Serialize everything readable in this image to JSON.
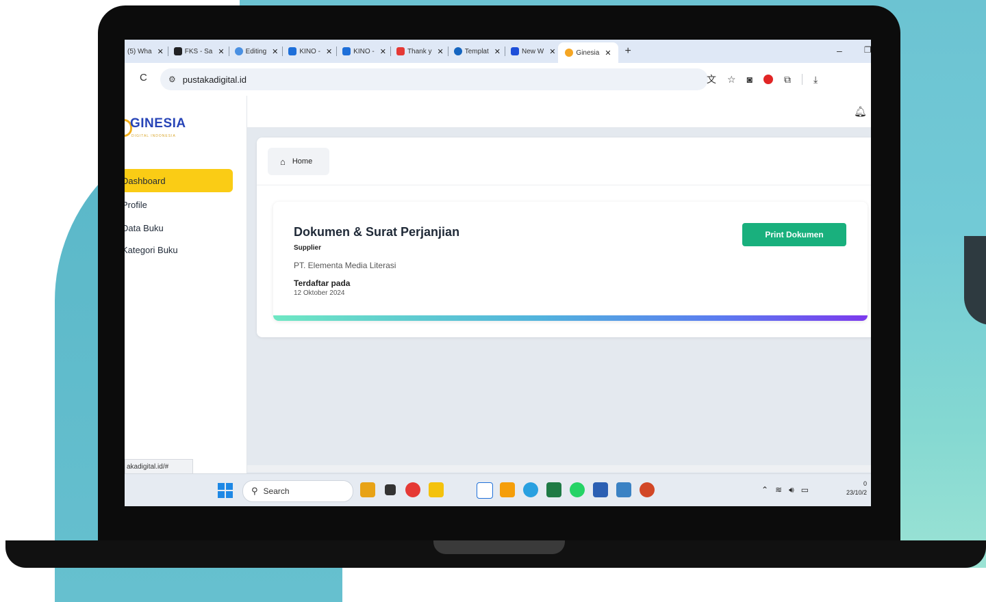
{
  "browser": {
    "tabs": [
      {
        "label": "(5) Wha",
        "color": "#9aa0a6"
      },
      {
        "label": "FKS - Sa",
        "color": "#202124"
      },
      {
        "label": "Editing",
        "color": "#4a90e2"
      },
      {
        "label": "KINO -",
        "color": "#1e6fd9"
      },
      {
        "label": "KINO -",
        "color": "#1e6fd9"
      },
      {
        "label": "Thank y",
        "color": "#e53935"
      },
      {
        "label": "Templat",
        "color": "#1565c0"
      },
      {
        "label": "New W",
        "color": "#1e4fd9"
      }
    ],
    "active_tab": {
      "label": "Ginesia",
      "color": "#f5a623"
    },
    "close_glyph": "✕",
    "new_tab_glyph": "+",
    "min_glyph": "–",
    "max_glyph": "❐",
    "url": "pustakadigital.id",
    "reload_glyph": "C"
  },
  "sidebar": {
    "logo": "GINESIA",
    "logo_sub": "DIGITAL INDONESIA",
    "items": [
      {
        "label": "Dashboard",
        "active": true
      },
      {
        "label": "Profile",
        "active": false
      },
      {
        "label": "Data Buku",
        "active": false
      },
      {
        "label": "Kategori Buku",
        "active": false
      }
    ],
    "status_url": "akadigital.id/#"
  },
  "breadcrumb": {
    "home": "Home"
  },
  "document": {
    "title": "Dokumen & Surat Perjanjian",
    "subtitle": "Supplier",
    "company": "PT. Elementa Media Literasi",
    "registered_label": "Terdaftar pada",
    "registered_date": "12 Oktober 2024",
    "print_button": "Print Dokumen"
  },
  "taskbar": {
    "search_placeholder": "Search",
    "date": "23/10/2",
    "time": "0"
  },
  "colors": {
    "accent_yellow": "#facc15",
    "button_green": "#19b07d",
    "logo_blue": "#2744b7"
  }
}
